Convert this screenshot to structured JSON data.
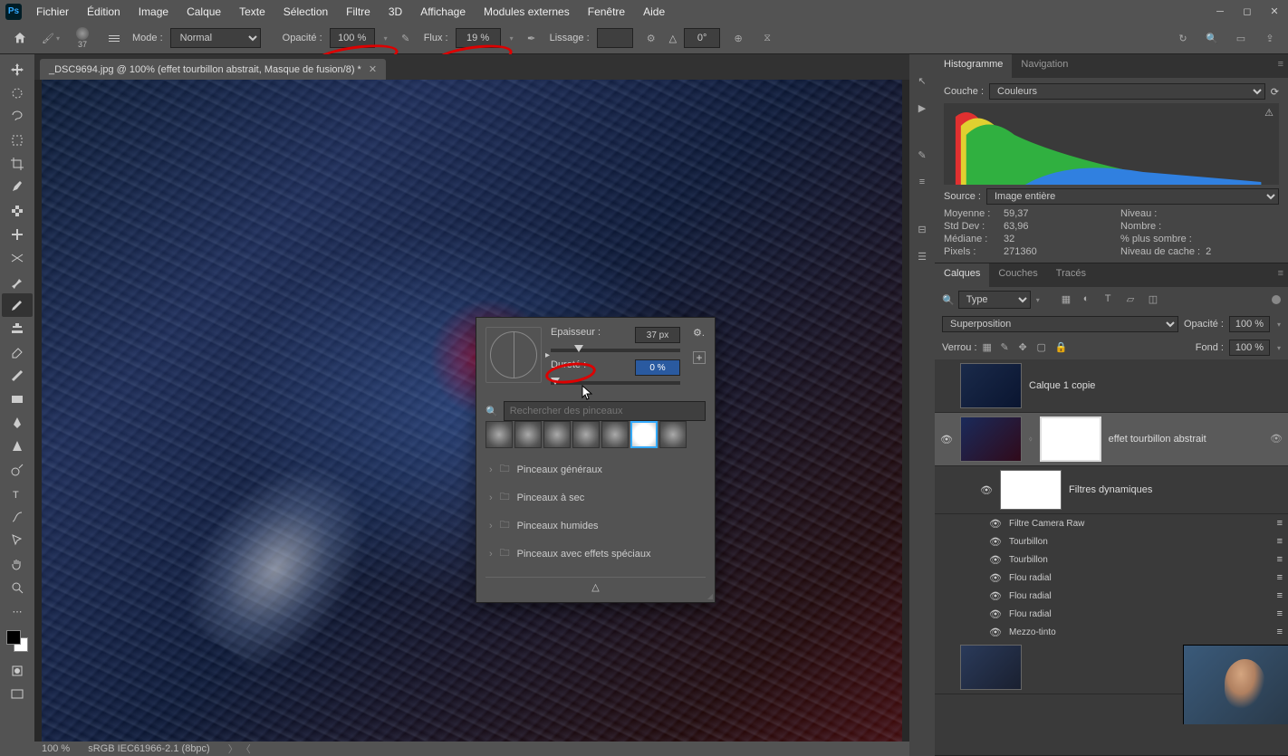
{
  "menubar": [
    "Fichier",
    "Édition",
    "Image",
    "Calque",
    "Texte",
    "Sélection",
    "Filtre",
    "3D",
    "Affichage",
    "Modules externes",
    "Fenêtre",
    "Aide"
  ],
  "options": {
    "brush_size": "37",
    "mode_label": "Mode :",
    "mode_value": "Normal",
    "opacity_label": "Opacité :",
    "opacity_value": "100 %",
    "flow_label": "Flux :",
    "flow_value": "19 %",
    "smoothing_label": "Lissage :",
    "smoothing_value": "",
    "angle_value": "0°"
  },
  "tab": {
    "title": "_DSC9694.jpg @ 100% (effet tourbillon abstrait, Masque de fusion/8) *"
  },
  "status": {
    "zoom": "100 %",
    "profile": "sRGB IEC61966-2.1 (8bpc)"
  },
  "histogram": {
    "tabs": [
      "Histogramme",
      "Navigation"
    ],
    "couche_label": "Couche :",
    "couche_value": "Couleurs",
    "source_label": "Source :",
    "source_value": "Image entière",
    "stats": {
      "moyenne_label": "Moyenne :",
      "moyenne_value": "59,37",
      "stddev_label": "Std Dev :",
      "stddev_value": "63,96",
      "mediane_label": "Médiane :",
      "mediane_value": "32",
      "pixels_label": "Pixels :",
      "pixels_value": "271360",
      "niveau_label": "Niveau :",
      "nombre_label": "Nombre :",
      "sombre_label": "% plus sombre :",
      "cache_label": "Niveau de cache :",
      "cache_value": "2"
    }
  },
  "layers": {
    "tabs": [
      "Calques",
      "Couches",
      "Tracés"
    ],
    "type_label": "Type",
    "blend_mode": "Superposition",
    "opacity_label": "Opacité :",
    "opacity_value": "100 %",
    "lock_label": "Verrou :",
    "fill_label": "Fond :",
    "fill_value": "100 %",
    "items": [
      {
        "name": "Calque 1 copie"
      },
      {
        "name": "effet tourbillon abstrait"
      },
      {
        "name": "Filtres dynamiques"
      }
    ],
    "filters": [
      "Filtre Camera Raw",
      "Tourbillon",
      "Tourbillon",
      "Flou radial",
      "Flou radial",
      "Flou radial",
      "Mezzo-tinto"
    ]
  },
  "brush_popup": {
    "thickness_label": "Epaisseur :",
    "thickness_value": "37 px",
    "hardness_label": "Dureté :",
    "hardness_value": "0 %",
    "search_placeholder": "Rechercher des pinceaux",
    "folders": [
      "Pinceaux généraux",
      "Pinceaux à sec",
      "Pinceaux humides",
      "Pinceaux avec effets spéciaux"
    ]
  }
}
